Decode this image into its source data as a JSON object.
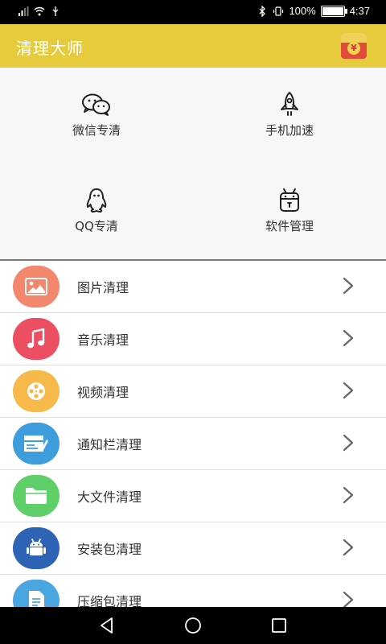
{
  "status_bar": {
    "battery": "100%",
    "time": "4:37"
  },
  "header": {
    "title": "清理大师",
    "coin_symbol": "¥"
  },
  "grid": [
    {
      "label": "微信专清",
      "icon": "wechat-icon"
    },
    {
      "label": "手机加速",
      "icon": "rocket-icon"
    },
    {
      "label": "QQ专清",
      "icon": "qq-penguin-icon"
    },
    {
      "label": "软件管理",
      "icon": "android-robot-icon"
    }
  ],
  "list": [
    {
      "label": "图片清理",
      "icon": "image-icon",
      "color": "#f3876e"
    },
    {
      "label": "音乐清理",
      "icon": "music-icon",
      "color": "#ec4f62"
    },
    {
      "label": "视频清理",
      "icon": "film-reel-icon",
      "color": "#f6b94a"
    },
    {
      "label": "通知栏清理",
      "icon": "notification-bar-icon",
      "color": "#3e9ddc"
    },
    {
      "label": "大文件清理",
      "icon": "folder-icon",
      "color": "#5fcf6a"
    },
    {
      "label": "安装包清理",
      "icon": "android-icon",
      "color": "#2f63b6"
    },
    {
      "label": "压缩包清理",
      "icon": "archive-icon",
      "color": "#4aa6e0"
    }
  ],
  "colors": {
    "header": "#e6cc3c",
    "grid_bg": "#f7f7f7"
  }
}
